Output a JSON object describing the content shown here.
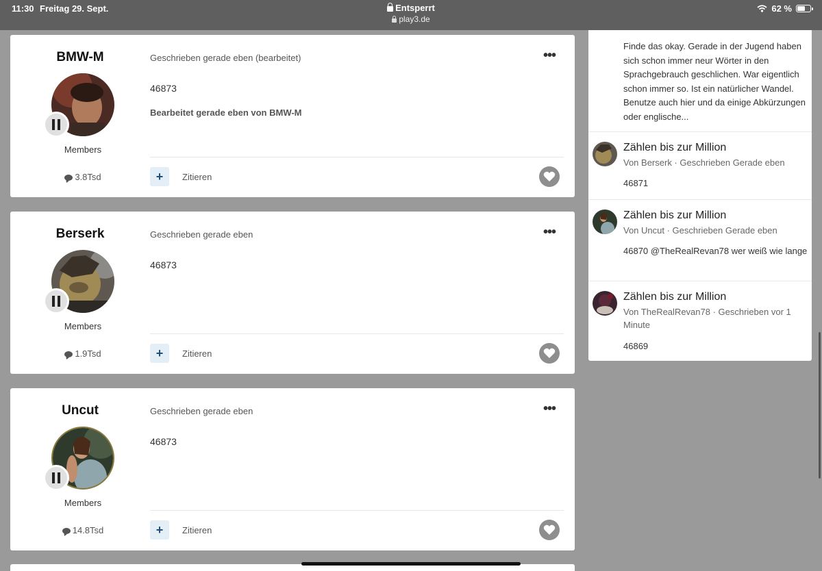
{
  "status_bar": {
    "time": "11:30",
    "date": "Freitag 29. Sept.",
    "lock_status": "Entsperrt",
    "url": "play3.de",
    "battery": "62 %",
    "battery_level": 0.62
  },
  "posts": [
    {
      "author": "BMW-M",
      "group": "Members",
      "post_count": "3.8Tsd",
      "meta": "Geschrieben gerade eben (bearbeitet)",
      "content": "46873",
      "edit_note": "Bearbeitet gerade eben von BMW-M",
      "quote_label": "Zitieren",
      "plus_label": "+"
    },
    {
      "author": "Berserk",
      "group": "Members",
      "post_count": "1.9Tsd",
      "meta": "Geschrieben gerade eben",
      "content": "46873",
      "quote_label": "Zitieren",
      "plus_label": "+"
    },
    {
      "author": "Uncut",
      "group": "Members",
      "post_count": "14.8Tsd",
      "meta": "Geschrieben gerade eben",
      "content": "46873",
      "quote_label": "Zitieren",
      "plus_label": "+"
    }
  ],
  "sidebar": {
    "first_excerpt": "Finde das okay. Gerade in der Jugend haben sich schon immer neur Wörter in den Sprachgebrauch geschlichen. War eigentlich schon immer so. Ist ein natürlicher Wandel. Benutze auch hier und da einige Abkürzungen oder englische...",
    "items": [
      {
        "title": "Zählen bis zur Million",
        "meta": "Von Berserk · Geschrieben Gerade eben",
        "text": "46871"
      },
      {
        "title": "Zählen bis zur Million",
        "meta": "Von Uncut · Geschrieben Gerade eben",
        "text": "46870 @TheRealRevan78 wer weiß wie lange"
      },
      {
        "title": "Zählen bis zur Million",
        "meta": "Von TheRealRevan78 · Geschrieben vor 1 Minute",
        "text": "46869"
      }
    ]
  },
  "icons": {
    "more": "more-options-icon",
    "like": "heart-icon",
    "posts": "chat-bubble-icon",
    "status": "pause-badge-icon"
  },
  "colors": {
    "page_background": "#9a9a9a",
    "status_bar": "#5f5f5f",
    "plus_button_bg": "#e4eef6",
    "plus_button_fg": "#1f4e79",
    "like_button": "#8e8e8e"
  }
}
